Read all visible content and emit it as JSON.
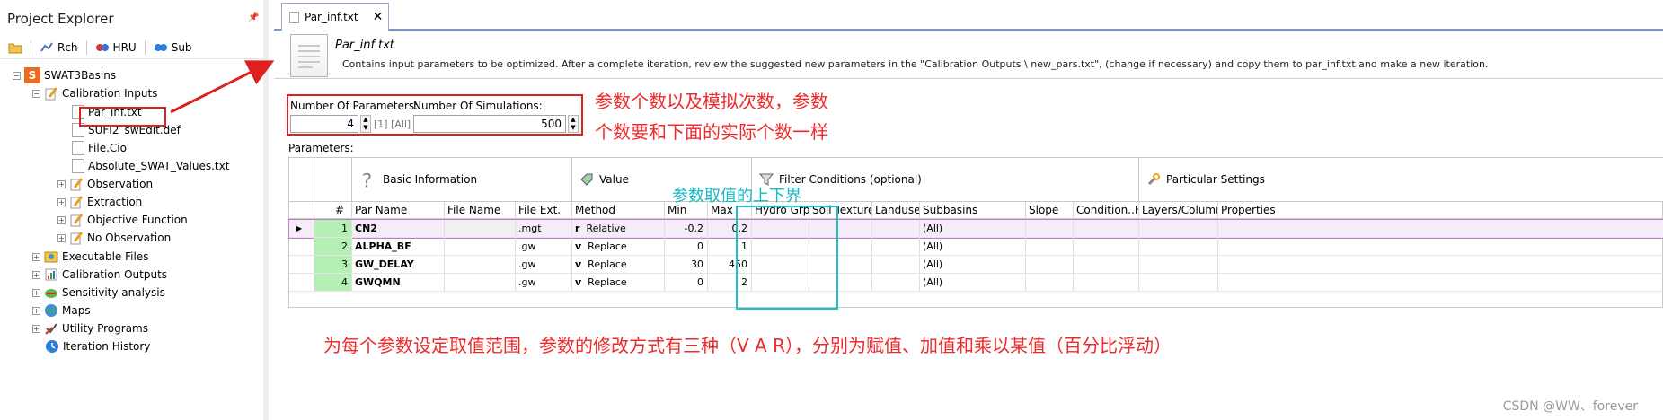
{
  "explorer": {
    "title": "Project Explorer",
    "toolbar": [
      "Rch",
      "HRU",
      "Sub"
    ],
    "tree": [
      {
        "label": "SWAT3Basins",
        "level": 0,
        "expander": "-",
        "icon": "swat-icon"
      },
      {
        "label": "Calibration Inputs",
        "level": 1,
        "expander": "-",
        "icon": "pencil-icon"
      },
      {
        "label": "Par_inf.txt",
        "level": 2,
        "expander": "",
        "icon": "file-icon"
      },
      {
        "label": "SUFI2_swEdit.def",
        "level": 2,
        "expander": "",
        "icon": "file-icon"
      },
      {
        "label": "File.Cio",
        "level": 2,
        "expander": "",
        "icon": "file-icon"
      },
      {
        "label": "Absolute_SWAT_Values.txt",
        "level": 2,
        "expander": "",
        "icon": "file-icon"
      },
      {
        "label": "Observation",
        "level": 2,
        "expander": "+",
        "icon": "pencil-icon"
      },
      {
        "label": "Extraction",
        "level": 2,
        "expander": "+",
        "icon": "pencil-icon"
      },
      {
        "label": "Objective Function",
        "level": 2,
        "expander": "+",
        "icon": "pencil-icon"
      },
      {
        "label": "No Observation",
        "level": 2,
        "expander": "+",
        "icon": "pencil-icon"
      },
      {
        "label": "Executable Files",
        "level": 1,
        "expander": "+",
        "icon": "executable-icon"
      },
      {
        "label": "Calibration Outputs",
        "level": 1,
        "expander": "+",
        "icon": "outputs-icon"
      },
      {
        "label": "Sensitivity analysis",
        "level": 1,
        "expander": "+",
        "icon": "sensitivity-icon"
      },
      {
        "label": "Maps",
        "level": 1,
        "expander": "+",
        "icon": "globe-icon"
      },
      {
        "label": "Utility Programs",
        "level": 1,
        "expander": "+",
        "icon": "utility-icon"
      },
      {
        "label": "Iteration History",
        "level": 1,
        "expander": "",
        "icon": "history-icon"
      }
    ]
  },
  "tab": {
    "label": "Par_inf.txt",
    "close": "✕"
  },
  "header": {
    "title": "Par_inf.txt",
    "description": "Contains input parameters to be optimized. After a complete iteration, review the suggested new parameters in the \"Calibration Outputs \\ new_pars.txt\", (change if necessary) and copy them to par_inf.txt and make a new iteration."
  },
  "settings": {
    "num_params_label": "Number Of Parameters:",
    "num_params_value": "4",
    "btn_one": "[1]",
    "btn_all": "[All]",
    "num_sims_label": "Number Of Simulations:",
    "num_sims_value": "500"
  },
  "parameters_label": "Parameters:",
  "bands": {
    "basic": "Basic Information",
    "value": "Value",
    "filter": "Filter Conditions (optional)",
    "particular": "Particular Settings"
  },
  "columns": [
    "#",
    "Par Name",
    "File Name",
    "File Ext.",
    "Method",
    "Min",
    "Max",
    "Hydro Grp",
    "Soil Texture",
    "Landuse",
    "Subbasins",
    "Slope",
    "Condition..Filt",
    "Layers/Columns",
    "Properties"
  ],
  "rows": [
    {
      "idx": "1",
      "par": "CN2",
      "file": "",
      "ext": ".mgt",
      "method_glyph": "r",
      "method": "Relative",
      "min": "-0.2",
      "max": "0.2",
      "subbasins": "(All)"
    },
    {
      "idx": "2",
      "par": "ALPHA_BF",
      "file": "",
      "ext": ".gw",
      "method_glyph": "v",
      "method": "Replace",
      "min": "0",
      "max": "1",
      "subbasins": "(All)"
    },
    {
      "idx": "3",
      "par": "GW_DELAY",
      "file": "",
      "ext": ".gw",
      "method_glyph": "v",
      "method": "Replace",
      "min": "30",
      "max": "450",
      "subbasins": "(All)"
    },
    {
      "idx": "4",
      "par": "GWQMN",
      "file": "",
      "ext": ".gw",
      "method_glyph": "v",
      "method": "Replace",
      "min": "0",
      "max": "2",
      "subbasins": "(All)"
    }
  ],
  "annotations": {
    "top_line1": "参数个数以及模拟次数，参数",
    "top_line2": "个数要和下面的实际个数一样",
    "range": "参数取值的上下界",
    "bottom": "为每个参数设定取值范围，参数的修改方式有三种（V A R），分别为赋值、加值和乘以某值（百分比浮动）"
  },
  "watermark": "CSDN @WW、forever",
  "colors": {
    "annotation_red": "#f02a2a",
    "annotation_cyan": "#17b9c3",
    "row_index_green": "#b4f0b4",
    "tab_accent": "#7b97c4"
  }
}
